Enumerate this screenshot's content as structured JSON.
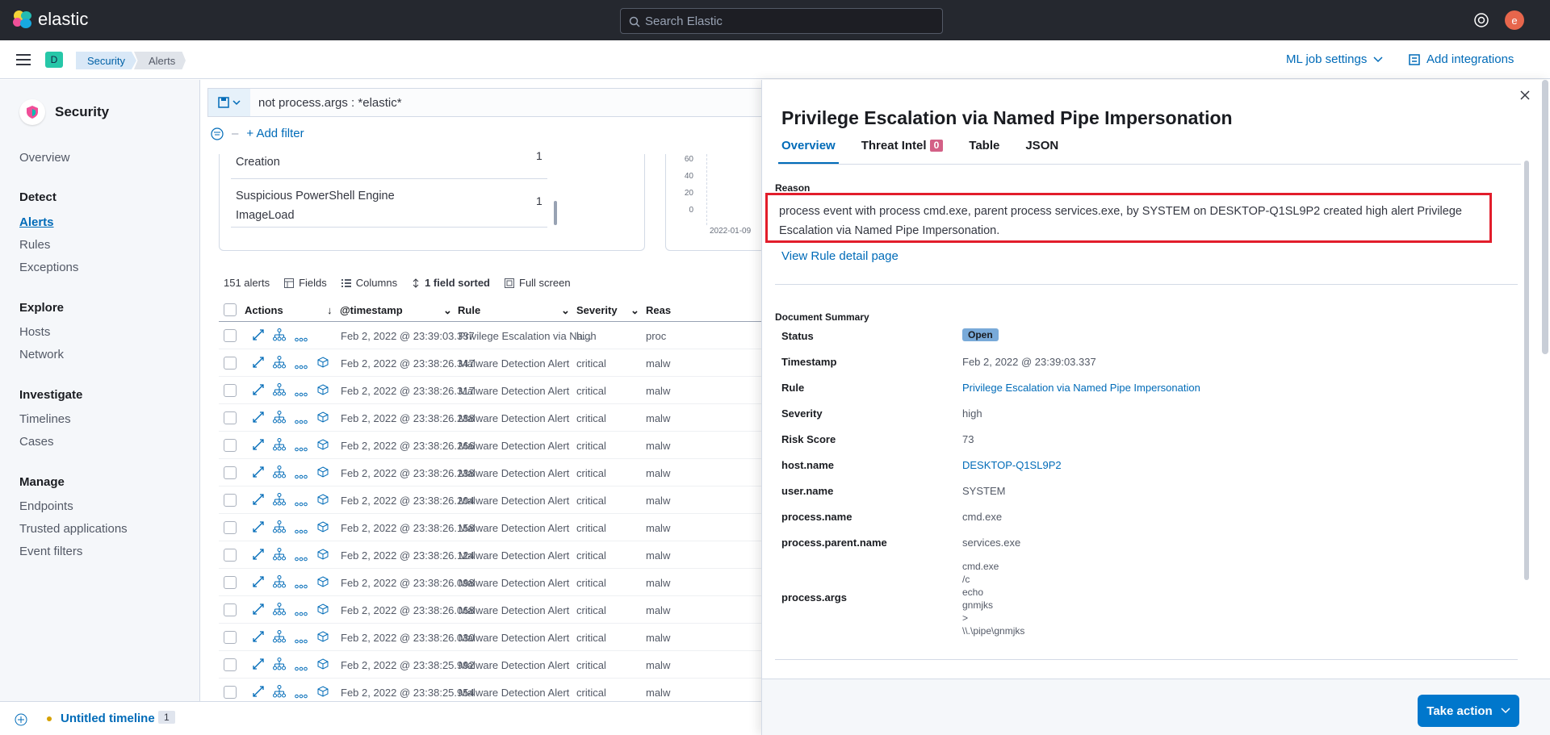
{
  "topbar": {
    "brand": "elastic",
    "search_placeholder": "Search Elastic",
    "avatar_letter": "e"
  },
  "subbar": {
    "space_letter": "D",
    "breadcrumbs": [
      "Security",
      "Alerts"
    ],
    "ml_settings": "ML job settings",
    "add_integrations": "Add integrations"
  },
  "sidebar": {
    "title": "Security",
    "overview": "Overview",
    "sections": [
      {
        "heading": "Detect",
        "items": [
          "Alerts",
          "Rules",
          "Exceptions"
        ]
      },
      {
        "heading": "Explore",
        "items": [
          "Hosts",
          "Network"
        ]
      },
      {
        "heading": "Investigate",
        "items": [
          "Timelines",
          "Cases"
        ]
      },
      {
        "heading": "Manage",
        "items": [
          "Endpoints",
          "Trusted applications",
          "Event filters"
        ]
      }
    ]
  },
  "query": {
    "text": "not process.args : *elastic*",
    "add_filter": "+ Add filter"
  },
  "top_panel": {
    "rows": [
      {
        "name": "Creation",
        "count": "1"
      },
      {
        "name_line1": "Suspicious PowerShell Engine",
        "name_line2": "ImageLoad",
        "count": "1"
      }
    ],
    "y_ticks": [
      "60",
      "40",
      "20",
      "0"
    ],
    "x_tick": "2022-01-09"
  },
  "table": {
    "count_label": "151 alerts",
    "fields": "Fields",
    "columns": "Columns",
    "sorted": "1 field sorted",
    "full_screen": "Full screen",
    "headers": {
      "actions": "Actions",
      "timestamp": "@timestamp",
      "rule": "Rule",
      "severity": "Severity",
      "reason": "Reas"
    },
    "rows": [
      {
        "ts": "Feb 2, 2022 @ 23:39:03.337",
        "rule": "Privilege Escalation via Na...",
        "sev": "high",
        "reason": "proc"
      },
      {
        "ts": "Feb 2, 2022 @ 23:38:26.347",
        "rule": "Malware Detection Alert",
        "sev": "critical",
        "reason": "malw"
      },
      {
        "ts": "Feb 2, 2022 @ 23:38:26.317",
        "rule": "Malware Detection Alert",
        "sev": "critical",
        "reason": "malw"
      },
      {
        "ts": "Feb 2, 2022 @ 23:38:26.288",
        "rule": "Malware Detection Alert",
        "sev": "critical",
        "reason": "malw"
      },
      {
        "ts": "Feb 2, 2022 @ 23:38:26.266",
        "rule": "Malware Detection Alert",
        "sev": "critical",
        "reason": "malw"
      },
      {
        "ts": "Feb 2, 2022 @ 23:38:26.238",
        "rule": "Malware Detection Alert",
        "sev": "critical",
        "reason": "malw"
      },
      {
        "ts": "Feb 2, 2022 @ 23:38:26.204",
        "rule": "Malware Detection Alert",
        "sev": "critical",
        "reason": "malw"
      },
      {
        "ts": "Feb 2, 2022 @ 23:38:26.158",
        "rule": "Malware Detection Alert",
        "sev": "critical",
        "reason": "malw"
      },
      {
        "ts": "Feb 2, 2022 @ 23:38:26.124",
        "rule": "Malware Detection Alert",
        "sev": "critical",
        "reason": "malw"
      },
      {
        "ts": "Feb 2, 2022 @ 23:38:26.098",
        "rule": "Malware Detection Alert",
        "sev": "critical",
        "reason": "malw"
      },
      {
        "ts": "Feb 2, 2022 @ 23:38:26.068",
        "rule": "Malware Detection Alert",
        "sev": "critical",
        "reason": "malw"
      },
      {
        "ts": "Feb 2, 2022 @ 23:38:26.030",
        "rule": "Malware Detection Alert",
        "sev": "critical",
        "reason": "malw"
      },
      {
        "ts": "Feb 2, 2022 @ 23:38:25.992",
        "rule": "Malware Detection Alert",
        "sev": "critical",
        "reason": "malw"
      },
      {
        "ts": "Feb 2, 2022 @ 23:38:25.954",
        "rule": "Malware Detection Alert",
        "sev": "critical",
        "reason": "malw"
      }
    ]
  },
  "timeline": {
    "name": "Untitled timeline",
    "count": "1"
  },
  "flyout": {
    "title": "Privilege Escalation via Named Pipe Impersonation",
    "tabs": [
      "Overview",
      "Threat Intel",
      "Table",
      "JSON"
    ],
    "threat_intel_count": "0",
    "reason_label": "Reason",
    "reason_text": "process event with process cmd.exe, parent process services.exe, by SYSTEM on DESKTOP-Q1SL9P2 created high alert Privilege Escalation via Named Pipe Impersonation.",
    "view_rule": "View Rule detail page",
    "summary_label": "Document Summary",
    "summary": {
      "status_k": "Status",
      "status_v": "Open",
      "timestamp_k": "Timestamp",
      "timestamp_v": "Feb 2, 2022 @ 23:39:03.337",
      "rule_k": "Rule",
      "rule_v": "Privilege Escalation via Named Pipe Impersonation",
      "severity_k": "Severity",
      "severity_v": "high",
      "risk_k": "Risk Score",
      "risk_v": "73",
      "host_k": "host.name",
      "host_v": "DESKTOP-Q1SL9P2",
      "user_k": "user.name",
      "user_v": "SYSTEM",
      "pname_k": "process.name",
      "pname_v": "cmd.exe",
      "parent_k": "process.parent.name",
      "parent_v": "services.exe",
      "args_k": "process.args",
      "args_v": [
        "cmd.exe",
        "/c",
        "echo",
        "gnmjks",
        ">",
        "\\\\.\\pipe\\gnmjks"
      ]
    },
    "take_action": "Take action"
  },
  "colors": {
    "accent": "#006bb8",
    "highlight": "#e21d2b",
    "badge": "#d36086",
    "topbar": "#25282f"
  }
}
